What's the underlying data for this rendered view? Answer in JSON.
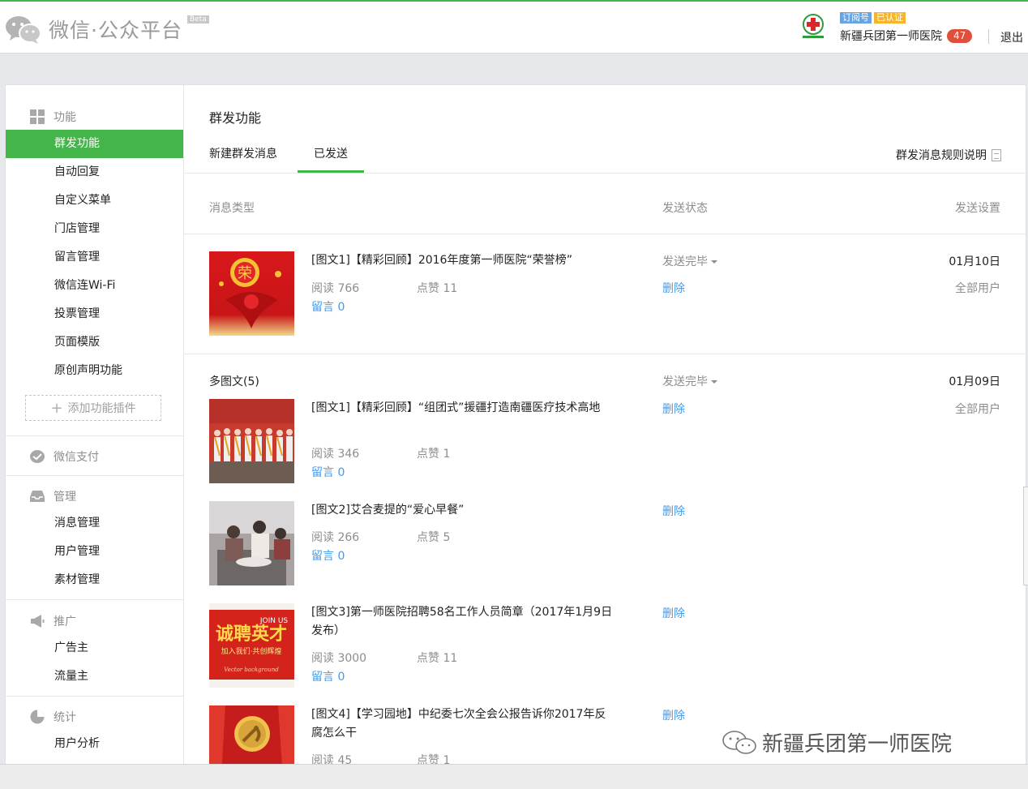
{
  "header": {
    "logo_text": "微信·公众平台",
    "beta": "Beta",
    "badge_type": "订阅号",
    "badge_verified": "已认证",
    "account_name": "新疆兵团第一师医院",
    "notification_count": "47",
    "logout": "退出"
  },
  "sidebar": {
    "group_function": "功能",
    "function_items": [
      "群发功能",
      "自动回复",
      "自定义菜单",
      "门店管理",
      "留言管理",
      "微信连Wi-Fi",
      "投票管理",
      "页面模版",
      "原创声明功能"
    ],
    "add_plugin": "添加功能插件",
    "group_pay": "微信支付",
    "group_manage": "管理",
    "manage_items": [
      "消息管理",
      "用户管理",
      "素材管理"
    ],
    "group_promote": "推广",
    "promote_items": [
      "广告主",
      "流量主"
    ],
    "group_stats": "统计",
    "stats_items": [
      "用户分析"
    ]
  },
  "content": {
    "page_title": "群发功能",
    "tabs": [
      "新建群发消息",
      "已发送"
    ],
    "rules_link": "群发消息规则说明",
    "columns": {
      "type": "消息类型",
      "status": "发送状态",
      "settings": "发送设置"
    },
    "read_label": "阅读",
    "like_label": "点赞",
    "comment_label": "留言",
    "delete_label": "删除",
    "messages": [
      {
        "status": "发送完毕",
        "date": "01月10日",
        "audience": "全部用户",
        "articles": [
          {
            "title": "[图文1]【精彩回顾】2016年度第一师医院“荣誉榜”",
            "reads": "766",
            "likes": "11",
            "comments": "0"
          }
        ]
      },
      {
        "group_label": "多图文(5)",
        "status": "发送完毕",
        "date": "01月09日",
        "audience": "全部用户",
        "articles": [
          {
            "title": "[图文1]【精彩回顾】“组团式”援疆打造南疆医疗技术高地",
            "reads": "346",
            "likes": "1",
            "comments": "0"
          },
          {
            "title": "[图文2]艾合麦提的“爱心早餐”",
            "reads": "266",
            "likes": "5",
            "comments": "0"
          },
          {
            "title": "[图文3]第一师医院招聘58名工作人员简章（2017年1月9日发布）",
            "reads": "3000",
            "likes": "11",
            "comments": "0"
          },
          {
            "title": "[图文4]【学习园地】中纪委七次全会公报告诉你2017年反腐怎么干",
            "reads": "45",
            "likes": "1",
            "comments": ""
          }
        ]
      }
    ]
  },
  "thumb_text": {
    "rong": "荣",
    "recruit_big": "诚聘英才",
    "recruit_en": "JOIN US",
    "recruit_sub": "加入我们·共创辉煌",
    "recruit_script": "Vector background"
  },
  "watermark": "新疆兵团第一师医院",
  "colors": {
    "accent": "#44b549",
    "link": "#459ae9",
    "muted": "#8d8d8d",
    "count_badge": "#e04f3c"
  }
}
